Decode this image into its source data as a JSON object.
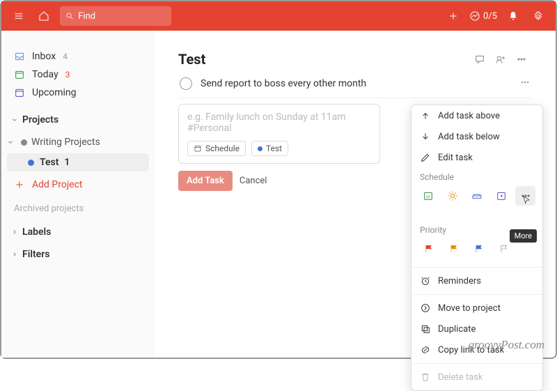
{
  "topbar": {
    "search_placeholder": "Find",
    "progress_text": "0/5"
  },
  "sidebar": {
    "inbox": {
      "label": "Inbox",
      "count": "4"
    },
    "today": {
      "label": "Today",
      "count": "3"
    },
    "upcoming": {
      "label": "Upcoming"
    },
    "projects_header": "Projects",
    "writing_projects": "Writing Projects",
    "test_project": {
      "label": "Test",
      "count": "1"
    },
    "add_project": "Add Project",
    "archived": "Archived projects",
    "labels": "Labels",
    "filters": "Filters"
  },
  "page": {
    "title": "Test",
    "task1": "Send report to boss every other month",
    "new_task_placeholder": "e.g. Family lunch on Sunday at 11am #Personal",
    "chip_schedule": "Schedule",
    "chip_project": "Test",
    "add_task_btn": "Add Task",
    "cancel_btn": "Cancel"
  },
  "context_menu": {
    "add_above": "Add task above",
    "add_below": "Add task below",
    "edit": "Edit task",
    "schedule_label": "Schedule",
    "priority_label": "Priority",
    "reminders": "Reminders",
    "move": "Move to project",
    "duplicate": "Duplicate",
    "copy_link": "Copy link to task",
    "delete": "Delete task",
    "more_tooltip": "More"
  },
  "colors": {
    "accent": "#e44332",
    "green": "#299438",
    "orange": "#eb8909",
    "blue": "#4073d6",
    "purple": "#6f42c1"
  },
  "watermark": "groovyPost.com"
}
